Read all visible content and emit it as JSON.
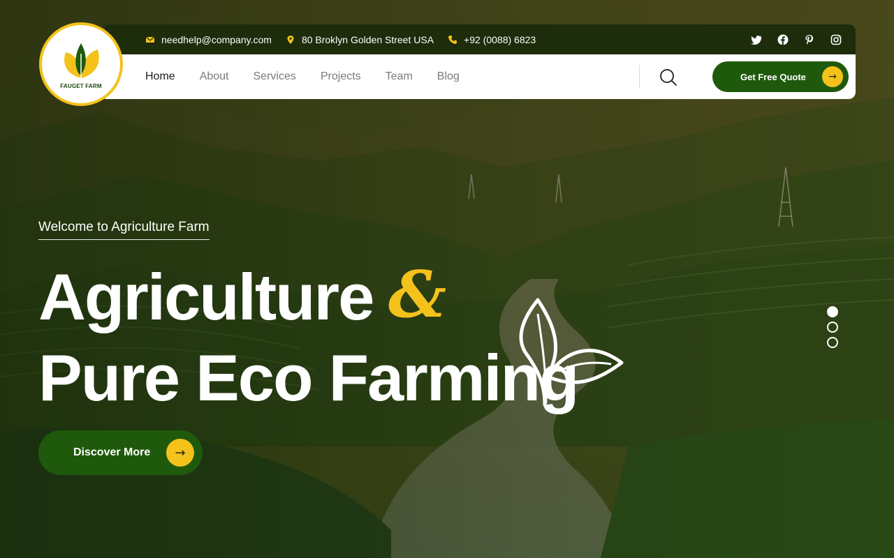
{
  "brand": {
    "name": "FAUGET FARM"
  },
  "topbar": {
    "email": "needhelp@company.com",
    "address": "80 Broklyn Golden Street USA",
    "phone": "+92 (0088) 6823",
    "socials": [
      "twitter-icon",
      "facebook-icon",
      "pinterest-icon",
      "instagram-icon"
    ]
  },
  "nav": {
    "items": [
      {
        "label": "Home",
        "active": true
      },
      {
        "label": "About",
        "active": false
      },
      {
        "label": "Services",
        "active": false
      },
      {
        "label": "Projects",
        "active": false
      },
      {
        "label": "Team",
        "active": false
      },
      {
        "label": "Blog",
        "active": false
      }
    ],
    "cta_label": "Get Free Quote"
  },
  "hero": {
    "kicker": "Welcome to Agriculture Farm",
    "headline_line1": "Agriculture",
    "ampersand": "&",
    "headline_line2": "Pure Eco Farming",
    "cta_label": "Discover More",
    "slides": {
      "count": 3,
      "active": 1
    }
  },
  "colors": {
    "primary_green": "#1f5a0c",
    "accent_yellow": "#f4c21b",
    "topbar_dark": "#1d2c0a",
    "nav_text": "#7a7a7a"
  }
}
